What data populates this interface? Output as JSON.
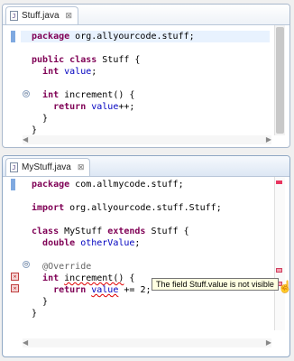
{
  "pane1": {
    "tab": {
      "icon_letter": "J",
      "label": "Stuff.java",
      "close": "⊠"
    },
    "code": [
      [
        [
          "kw",
          "package"
        ],
        [
          "txt",
          " org.allyourcode.stuff;"
        ]
      ],
      [],
      [
        [
          "kw",
          "public"
        ],
        [
          "txt",
          " "
        ],
        [
          "kw",
          "class"
        ],
        [
          "txt",
          " Stuff {"
        ]
      ],
      [
        [
          "txt",
          "  "
        ],
        [
          "kw",
          "int"
        ],
        [
          "txt",
          " "
        ],
        [
          "fld",
          "value"
        ],
        [
          "txt",
          ";"
        ]
      ],
      [],
      [
        [
          "txt",
          "  "
        ],
        [
          "kw",
          "int"
        ],
        [
          "txt",
          " increment() {"
        ]
      ],
      [
        [
          "txt",
          "    "
        ],
        [
          "kw",
          "return"
        ],
        [
          "txt",
          " "
        ],
        [
          "fld",
          "value"
        ],
        [
          "txt",
          "++;"
        ]
      ],
      [
        [
          "txt",
          "  }"
        ]
      ],
      [
        [
          "txt",
          "}"
        ]
      ]
    ]
  },
  "pane2": {
    "tab": {
      "icon_letter": "J",
      "label": "MyStuff.java",
      "close": "⊠"
    },
    "code": [
      [
        [
          "kw",
          "package"
        ],
        [
          "txt",
          " com.allmycode.stuff;"
        ]
      ],
      [],
      [
        [
          "kw",
          "import"
        ],
        [
          "txt",
          " org.allyourcode.stuff.Stuff;"
        ]
      ],
      [],
      [
        [
          "kw",
          "class"
        ],
        [
          "txt",
          " MyStuff "
        ],
        [
          "kw",
          "extends"
        ],
        [
          "txt",
          " Stuff {"
        ]
      ],
      [
        [
          "txt",
          "  "
        ],
        [
          "kw",
          "double"
        ],
        [
          "txt",
          " "
        ],
        [
          "fld",
          "otherValue"
        ],
        [
          "txt",
          ";"
        ]
      ],
      [],
      [
        [
          "txt",
          "  "
        ],
        [
          "ann",
          "@Override"
        ]
      ],
      [
        [
          "txt",
          "  "
        ],
        [
          "kw",
          "int"
        ],
        [
          "txt",
          " "
        ],
        [
          "err",
          "increment()"
        ],
        [
          "txt",
          " {"
        ]
      ],
      [
        [
          "txt",
          "    "
        ],
        [
          "kw",
          "return"
        ],
        [
          "txt",
          " "
        ],
        [
          "errfld",
          "value"
        ],
        [
          "txt",
          " += 2;"
        ]
      ],
      [
        [
          "txt",
          "  }"
        ]
      ],
      [
        [
          "txt",
          "}"
        ]
      ]
    ],
    "tooltip": "The field Stuff.value is not visible"
  },
  "icons": {
    "fold": "⊖",
    "error": "✕",
    "hand": "☝",
    "arrow_left": "◀",
    "arrow_right": "▶"
  },
  "colors": {
    "keyword": "#7f0055",
    "field": "#0000c0",
    "annotation": "#646464",
    "error": "#e00000"
  }
}
